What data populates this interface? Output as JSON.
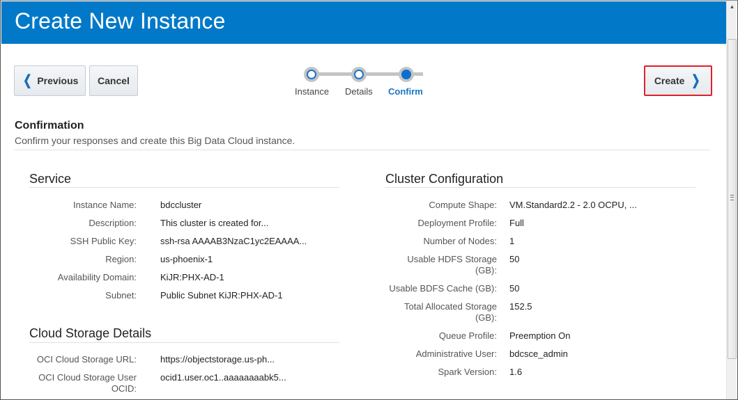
{
  "header": {
    "title": "Create New Instance"
  },
  "toolbar": {
    "previous_label": "Previous",
    "cancel_label": "Cancel",
    "create_label": "Create"
  },
  "train": {
    "steps": [
      {
        "label": "Instance",
        "state": "visited"
      },
      {
        "label": "Details",
        "state": "visited"
      },
      {
        "label": "Confirm",
        "state": "current"
      }
    ]
  },
  "confirmation": {
    "title": "Confirmation",
    "description": "Confirm your responses and create this Big Data Cloud instance."
  },
  "service": {
    "title": "Service",
    "fields": [
      {
        "label": "Instance Name:",
        "value": "bdccluster"
      },
      {
        "label": "Description:",
        "value": "This cluster is created for..."
      },
      {
        "label": "SSH Public Key:",
        "value": "ssh-rsa AAAAB3NzaC1yc2EAAAA..."
      },
      {
        "label": "Region:",
        "value": "us-phoenix-1"
      },
      {
        "label": "Availability Domain:",
        "value": "KiJR:PHX-AD-1"
      },
      {
        "label": "Subnet:",
        "value": "Public Subnet KiJR:PHX-AD-1"
      }
    ]
  },
  "cloud_storage": {
    "title": "Cloud Storage Details",
    "fields": [
      {
        "label": "OCI Cloud Storage URL:",
        "value": "https://objectstorage.us-ph..."
      },
      {
        "label": "OCI Cloud Storage User OCID:",
        "value": "ocid1.user.oc1..aaaaaaaabk5..."
      }
    ]
  },
  "cluster_config": {
    "title": "Cluster Configuration",
    "fields": [
      {
        "label": "Compute Shape:",
        "value": "VM.Standard2.2 - 2.0 OCPU, ..."
      },
      {
        "label": "Deployment Profile:",
        "value": "Full"
      },
      {
        "label": "Number of Nodes:",
        "value": "1"
      },
      {
        "label": "Usable HDFS Storage (GB):",
        "value": "50"
      },
      {
        "label": "Usable BDFS Cache (GB):",
        "value": "50"
      },
      {
        "label": "Total Allocated Storage (GB):",
        "value": "152.5"
      },
      {
        "label": "Queue Profile:",
        "value": "Preemption On"
      },
      {
        "label": "Administrative User:",
        "value": "bdcsce_admin"
      },
      {
        "label": "Spark Version:",
        "value": "1.6"
      }
    ]
  },
  "colors": {
    "header_bg": "#0279c8",
    "accent": "#1a74c8",
    "create_highlight": "#e0202a"
  }
}
